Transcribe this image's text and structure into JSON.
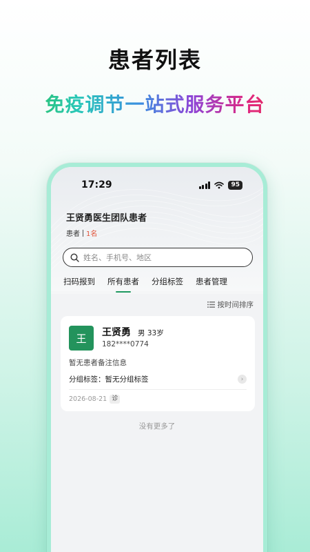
{
  "promo": {
    "title": "患者列表",
    "subtitle": "免疫调节一站式服务平台"
  },
  "status_bar": {
    "time": "17:29",
    "battery": "95"
  },
  "header": {
    "team_title": "王贤勇医生团队患者",
    "count_label": "患者",
    "count_value": "1名"
  },
  "search": {
    "placeholder": "姓名、手机号、地区"
  },
  "tabs": [
    {
      "label": "扫码报到",
      "active": false
    },
    {
      "label": "所有患者",
      "active": true
    },
    {
      "label": "分组标签",
      "active": false
    },
    {
      "label": "患者管理",
      "active": false
    }
  ],
  "sort": {
    "label": "按时间排序"
  },
  "patients": [
    {
      "avatar_char": "王",
      "name": "王贤勇",
      "info": "男 33岁",
      "phone": "182****0774",
      "remark": "暂无患者备注信息",
      "group_label": "分组标签：",
      "group_value": "暂无分组标签",
      "date": "2026-08-21",
      "badge": "诊"
    }
  ],
  "footer": {
    "no_more": "没有更多了"
  },
  "colors": {
    "accent": "#23935c",
    "count_highlight": "#e2553c"
  }
}
